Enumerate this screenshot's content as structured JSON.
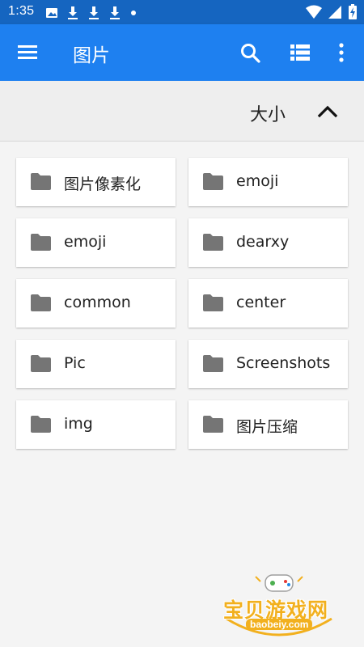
{
  "status_bar": {
    "time": "1:35",
    "left_icons": [
      "image-notification-icon",
      "download-icon",
      "download-icon",
      "download-icon",
      "dot-icon"
    ],
    "right_icons": [
      "wifi-icon",
      "signal-icon",
      "battery-charging-icon"
    ]
  },
  "app_bar": {
    "title": "图片",
    "background": "#1e80f0",
    "icons": [
      "menu-icon",
      "search-icon",
      "list-view-icon",
      "more-vert-icon"
    ]
  },
  "sort_bar": {
    "label": "大小",
    "direction_icon": "chevron-up-icon"
  },
  "folders": [
    {
      "name": "图片像素化"
    },
    {
      "name": "emoji"
    },
    {
      "name": "emoji"
    },
    {
      "name": "dearxy"
    },
    {
      "name": "common"
    },
    {
      "name": "center"
    },
    {
      "name": "Pic"
    },
    {
      "name": "Screenshots"
    },
    {
      "name": "img"
    },
    {
      "name": "图片压缩"
    }
  ],
  "watermark": {
    "brand": "宝贝游戏网",
    "url": "baobeiy.com"
  },
  "colors": {
    "status_bar": "#1565c0",
    "app_bar": "#1e80f0",
    "folder_icon": "#757575",
    "watermark": "#f2b01e"
  }
}
